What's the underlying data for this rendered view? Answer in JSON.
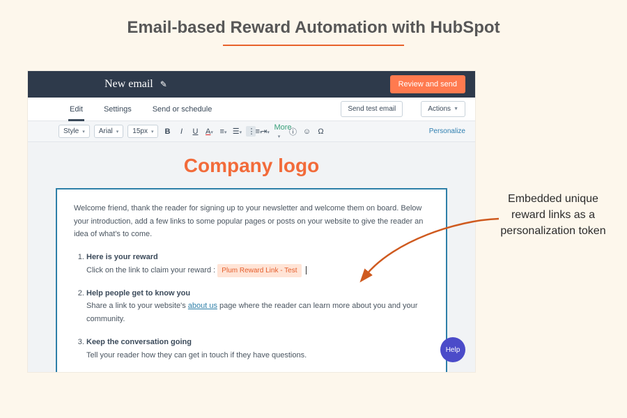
{
  "page": {
    "title": "Email-based Reward Automation with HubSpot"
  },
  "topbar": {
    "title": "New email",
    "review_btn": "Review and send"
  },
  "nav": {
    "tabs": [
      "Edit",
      "Settings",
      "Send or schedule"
    ],
    "active_index": 0,
    "send_test_btn": "Send test email",
    "actions_btn": "Actions"
  },
  "fmt": {
    "style_dd": "Style",
    "font_dd": "Arial",
    "size_dd": "15px",
    "more_label": "More",
    "personalize_label": "Personalize"
  },
  "email": {
    "logo_text": "Company logo",
    "intro": "Welcome friend, thank the reader for signing up to your newsletter and welcome them on board. Below your introduction, add a few links to some popular pages or posts on your website to give the reader an idea of what's to come.",
    "items": [
      {
        "title": "Here is your reward",
        "body_prefix": "Click on the link to claim your reward :  ",
        "token": "Plum Reward Link - Test"
      },
      {
        "title": "Help people get to know you",
        "body_prefix": "Share a link to your website's ",
        "link_text": "about us",
        "body_suffix": " page where the reader can learn more about you and your community."
      },
      {
        "title": "Keep the conversation going",
        "body_prefix": "Tell your reader how they can get in touch if they have questions."
      }
    ]
  },
  "help": {
    "label": "Help"
  },
  "annotation": {
    "text": "Embedded unique reward links as a personalization token"
  },
  "colors": {
    "accent_orange": "#e8622b",
    "hubspot_orange": "#ff7a4f",
    "dark_nav": "#2e3a4b",
    "body_border": "#2e7fa8",
    "token_bg": "#ffe4d6",
    "help_purple": "#4b4bc9"
  }
}
